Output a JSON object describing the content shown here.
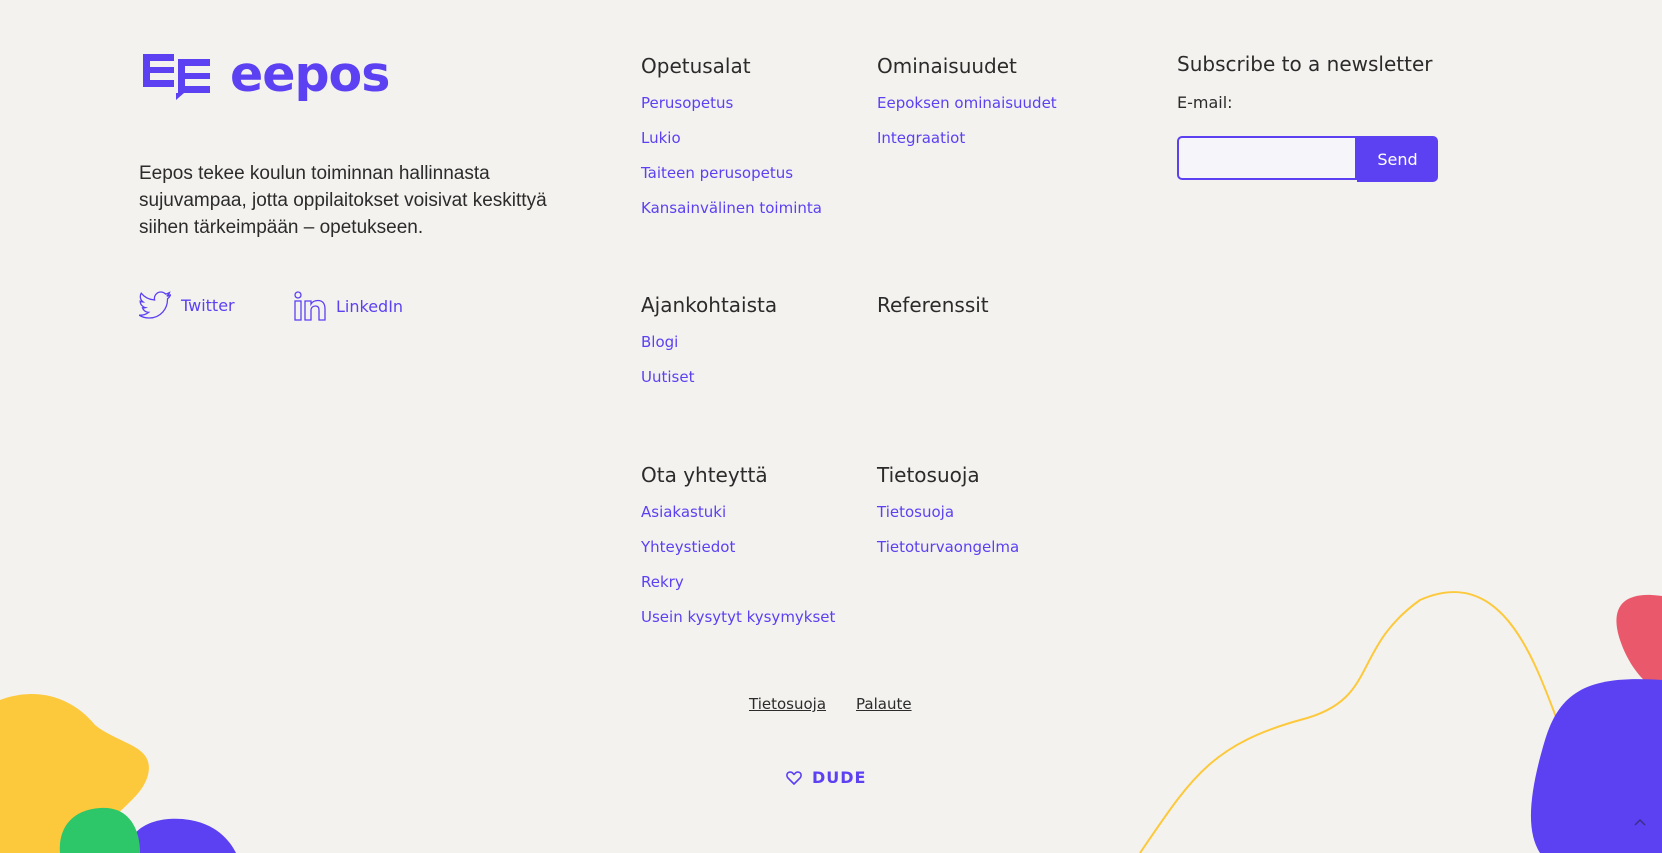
{
  "brand": {
    "logo_text": "eepos",
    "description": "Eepos tekee koulun toiminnan hallinnasta sujuvampaa, jotta oppilaitokset voisivat keskittyä siihen tärkeimpään – opetukseen.",
    "accent_color": "#5b41f2"
  },
  "social": [
    {
      "label": "Twitter",
      "icon": "twitter-icon"
    },
    {
      "label": "LinkedIn",
      "icon": "linkedin-icon"
    }
  ],
  "groups": {
    "opetusalat": {
      "title": "Opetusalat",
      "links": [
        "Perusopetus",
        "Lukio",
        "Taiteen perusopetus",
        "Kansainvälinen toiminta"
      ]
    },
    "ominaisuudet": {
      "title": "Ominaisuudet",
      "links": [
        "Eepoksen ominaisuudet",
        "Integraatiot"
      ]
    },
    "ajankohtaista": {
      "title": "Ajankohtaista",
      "links": [
        "Blogi",
        "Uutiset"
      ]
    },
    "referenssit": {
      "title": "Referenssit",
      "links": []
    },
    "ota": {
      "title": "Ota yhteyttä",
      "links": [
        "Asiakastuki",
        "Yhteystiedot",
        "Rekry",
        "Usein kysytyt kysymykset"
      ]
    },
    "tietosuoja": {
      "title": "Tietosuoja",
      "links": [
        "Tietosuoja",
        "Tietoturvaongelma"
      ]
    }
  },
  "newsletter": {
    "title": "Subscribe to a newsletter",
    "email_label": "E-mail:",
    "email_value": "",
    "send_label": "Send"
  },
  "bottom_links": [
    "Tietosuoja",
    "Palaute"
  ],
  "credit": {
    "label": "DUDE",
    "icon": "heart-icon"
  },
  "colors": {
    "background": "#f4f2ef",
    "accent": "#5b41f2",
    "blob_yellow": "#fdc93c",
    "blob_green": "#2dc769",
    "blob_pink": "#e9596b"
  }
}
